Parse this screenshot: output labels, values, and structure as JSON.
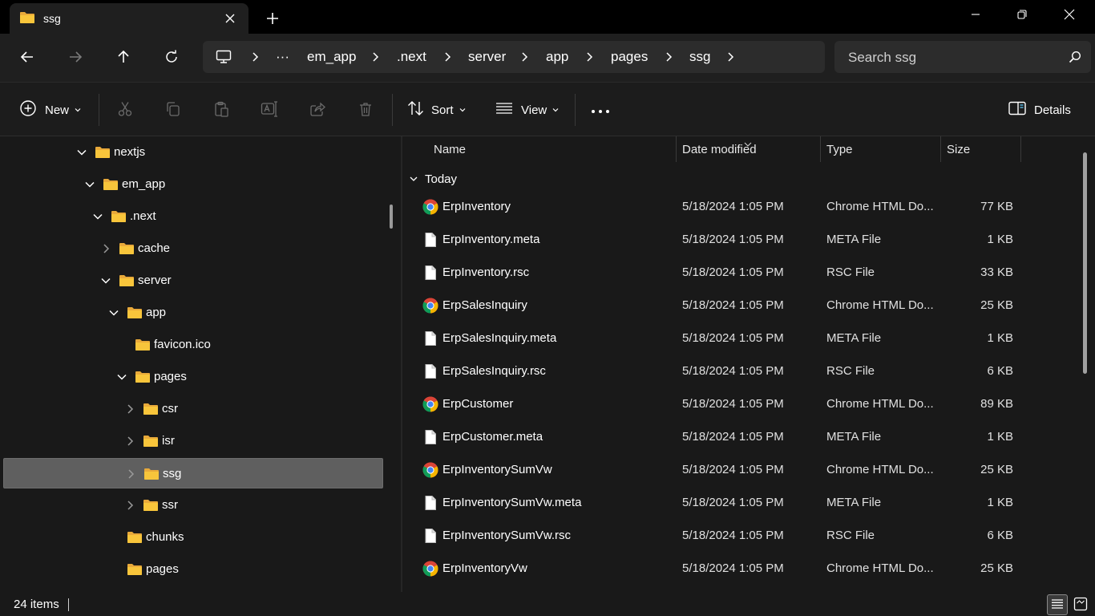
{
  "window": {
    "tab_title": "ssg",
    "tab_icon": "folder-icon",
    "controls": [
      "minimize-icon",
      "restore-icon",
      "close-icon"
    ]
  },
  "nav": {
    "back": "arrow-left-icon",
    "forward": "arrow-right-icon",
    "up": "arrow-up-icon",
    "refresh": "refresh-icon"
  },
  "breadcrumb": {
    "overflow": "···",
    "items": [
      "em_app",
      ".next",
      "server",
      "app",
      "pages",
      "ssg"
    ]
  },
  "search": {
    "placeholder": "Search ssg"
  },
  "toolbar": {
    "new_label": "New",
    "sort_label": "Sort",
    "view_label": "View",
    "details_label": "Details",
    "more_label": "···"
  },
  "tree": [
    {
      "label": "nextjs",
      "expanded": true,
      "depth": 0
    },
    {
      "label": "em_app",
      "expanded": true,
      "depth": 1
    },
    {
      "label": ".next",
      "expanded": true,
      "depth": 2
    },
    {
      "label": "cache",
      "expanded": false,
      "depth": 3
    },
    {
      "label": "server",
      "expanded": true,
      "depth": 3
    },
    {
      "label": "app",
      "expanded": true,
      "depth": 4
    },
    {
      "label": "favicon.ico",
      "expanded": null,
      "depth": 5
    },
    {
      "label": "pages",
      "expanded": true,
      "depth": 5
    },
    {
      "label": "csr",
      "expanded": false,
      "depth": 6
    },
    {
      "label": "isr",
      "expanded": false,
      "depth": 6
    },
    {
      "label": "ssg",
      "expanded": false,
      "depth": 6,
      "selected": true
    },
    {
      "label": "ssr",
      "expanded": false,
      "depth": 6
    },
    {
      "label": "chunks",
      "expanded": null,
      "depth": 4
    },
    {
      "label": "pages",
      "expanded": null,
      "depth": 4
    }
  ],
  "columns": {
    "name": "Name",
    "date": "Date modified",
    "type": "Type",
    "size": "Size"
  },
  "group": {
    "label": "Today"
  },
  "files": [
    {
      "name": "ErpInventory",
      "date": "5/18/2024 1:05 PM",
      "type": "Chrome HTML Do...",
      "size": "77 KB",
      "icon": "chrome-icon"
    },
    {
      "name": "ErpInventory.meta",
      "date": "5/18/2024 1:05 PM",
      "type": "META File",
      "size": "1 KB",
      "icon": "file-icon"
    },
    {
      "name": "ErpInventory.rsc",
      "date": "5/18/2024 1:05 PM",
      "type": "RSC File",
      "size": "33 KB",
      "icon": "file-icon"
    },
    {
      "name": "ErpSalesInquiry",
      "date": "5/18/2024 1:05 PM",
      "type": "Chrome HTML Do...",
      "size": "25 KB",
      "icon": "chrome-icon"
    },
    {
      "name": "ErpSalesInquiry.meta",
      "date": "5/18/2024 1:05 PM",
      "type": "META File",
      "size": "1 KB",
      "icon": "file-icon"
    },
    {
      "name": "ErpSalesInquiry.rsc",
      "date": "5/18/2024 1:05 PM",
      "type": "RSC File",
      "size": "6 KB",
      "icon": "file-icon"
    },
    {
      "name": "ErpCustomer",
      "date": "5/18/2024 1:05 PM",
      "type": "Chrome HTML Do...",
      "size": "89 KB",
      "icon": "chrome-icon"
    },
    {
      "name": "ErpCustomer.meta",
      "date": "5/18/2024 1:05 PM",
      "type": "META File",
      "size": "1 KB",
      "icon": "file-icon"
    },
    {
      "name": "ErpInventorySumVw",
      "date": "5/18/2024 1:05 PM",
      "type": "Chrome HTML Do...",
      "size": "25 KB",
      "icon": "chrome-icon"
    },
    {
      "name": "ErpInventorySumVw.meta",
      "date": "5/18/2024 1:05 PM",
      "type": "META File",
      "size": "1 KB",
      "icon": "file-icon"
    },
    {
      "name": "ErpInventorySumVw.rsc",
      "date": "5/18/2024 1:05 PM",
      "type": "RSC File",
      "size": "6 KB",
      "icon": "file-icon"
    },
    {
      "name": "ErpInventoryVw",
      "date": "5/18/2024 1:05 PM",
      "type": "Chrome HTML Do...",
      "size": "25 KB",
      "icon": "chrome-icon"
    }
  ],
  "status": {
    "count": "24 items"
  },
  "colors": {
    "background": "#191919",
    "titlebar": "#000000",
    "folder": "#f8c53b",
    "selection": "#5f5f5f",
    "accent": "#60cdff"
  }
}
